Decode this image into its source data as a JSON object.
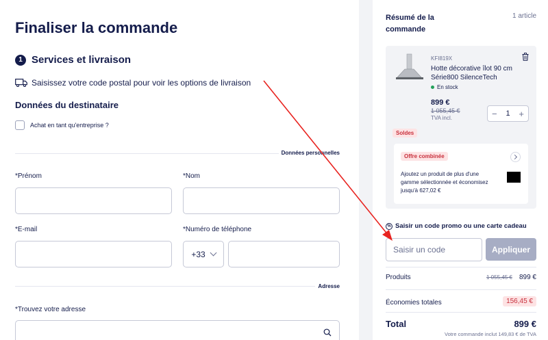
{
  "page": {
    "title": "Finaliser la commande"
  },
  "section": {
    "number": "1",
    "title": "Services et livraison"
  },
  "delivery": {
    "postal_hint": "Saisissez votre code postal pour voir les options de livraison"
  },
  "recipient": {
    "title": "Données du destinataire",
    "company_checkbox_label": "Achat en tant qu'entreprise ?",
    "personal_divider": "Données personnelles",
    "address_divider": "Adresse",
    "first_name": {
      "label": "*Prénom",
      "value": ""
    },
    "last_name": {
      "label": "*Nom",
      "value": ""
    },
    "email": {
      "label": "*E-mail",
      "value": ""
    },
    "phone": {
      "label": "*Numéro de téléphone",
      "prefix": "+33",
      "value": ""
    },
    "address": {
      "label": "*Trouvez votre adresse",
      "value": ""
    }
  },
  "summary": {
    "title": "Résumé de la commande",
    "count": "1 article",
    "product": {
      "sku": "KFI819X",
      "name": "Hotte décorative îlot 90 cm Série800 SilenceTech",
      "stock": "En stock",
      "price": "899 €",
      "old_price": "1 055,45 €",
      "vat": "TVA incl.",
      "quantity": "1",
      "minus": "−",
      "plus": "+",
      "sale_badge": "Soldes"
    },
    "offer": {
      "tag": "Offre combinée",
      "text": "Ajoutez un produit de plus d'une gamme sélectionnée et économisez jusqu'à 627,02 €"
    },
    "promo": {
      "title": "Saisir un code promo ou une carte cadeau",
      "icon_text": "%",
      "placeholder": "Saisir un code",
      "apply_label": "Appliquer"
    },
    "products_label": "Produits",
    "products_old": "1 055,45 €",
    "products_value": "899 €",
    "savings_label": "Économies totales",
    "savings_value": "156,45 €",
    "total_label": "Total",
    "total_value": "899 €",
    "vat_note": "Votre commande inclut 149,83 € de TVA"
  },
  "colors": {
    "navy": "#141c4b",
    "accent_red": "#c8303c",
    "annotation_arrow": "#e8231f",
    "apply_disabled": "#a7adc4"
  }
}
